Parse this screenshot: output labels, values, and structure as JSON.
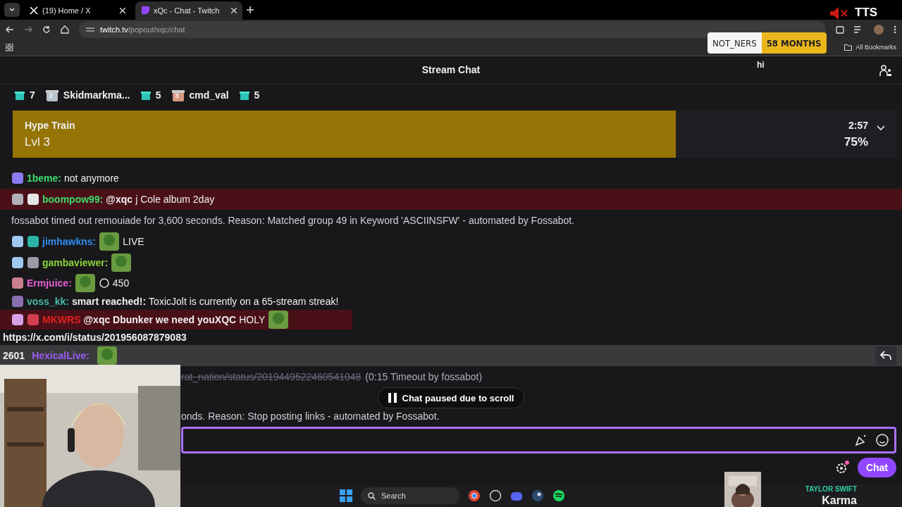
{
  "browser": {
    "tabs": [
      {
        "title": "(19) Home / X",
        "kind": "x",
        "selected": false
      },
      {
        "title": "xQc - Chat - Twitch",
        "kind": "twitch",
        "selected": true
      }
    ],
    "url_host": "twitch.tv",
    "url_path": "/popout/xqc/chat",
    "bookmarks_label": "All Bookmarks"
  },
  "overlay": {
    "sub_name": "NOT_NERS",
    "sub_months": "58 MONTHS",
    "tts": "TTS",
    "caption": "hi"
  },
  "chat": {
    "title": "Stream Chat",
    "leaderboard": [
      {
        "kind": "count",
        "text": "7"
      },
      {
        "kind": "user",
        "rank": "2",
        "name": "Skidmarkma..."
      },
      {
        "kind": "count",
        "text": "5"
      },
      {
        "kind": "user",
        "rank": "3",
        "name": "cmd_val"
      },
      {
        "kind": "count",
        "text": "5"
      }
    ],
    "hype_train": {
      "title": "Hype Train",
      "level_text": "Lvl 3",
      "time": "2:57",
      "percent": "75%",
      "level": 0.75
    },
    "messages": [
      {
        "kind": "chat",
        "user": "1beme:",
        "color": "#3ddc6c",
        "highlighted": false,
        "badges": [
          {
            "color": "#8a7cf0"
          }
        ],
        "parts": [
          {
            "kind": "text",
            "text": "not anymore"
          }
        ]
      },
      {
        "kind": "chat",
        "user": "boompow99:",
        "color": "#3ddc6c",
        "highlighted": true,
        "badges": [
          {
            "color": "#b0b0b8"
          },
          {
            "color": "#e6e6e6"
          }
        ],
        "parts": [
          {
            "kind": "mention",
            "text": "@xqc"
          },
          {
            "kind": "text",
            "text": "j Cole album 2day"
          }
        ]
      },
      {
        "kind": "system",
        "text": "fossabot timed out remouiade for 3,600 seconds. Reason: Matched group 49 in Keyword 'ASCIINSFW' - automated by Fossabot."
      },
      {
        "kind": "chat",
        "user": "jimhawkns:",
        "color": "#2f8cf0",
        "highlighted": false,
        "badges": [
          {
            "color": "#9ec8f0"
          },
          {
            "color": "#2bb3a8"
          }
        ],
        "parts": [
          {
            "kind": "emote"
          },
          {
            "kind": "text",
            "text": "LIVE"
          }
        ]
      },
      {
        "kind": "chat",
        "user": "gambaviewer:",
        "color": "#8ad43c",
        "highlighted": false,
        "badges": [
          {
            "color": "#9ec8f0"
          },
          {
            "color": "#9a9aa8"
          }
        ],
        "parts": [
          {
            "kind": "emote"
          }
        ]
      },
      {
        "kind": "chat",
        "user": "Ermjuice:",
        "color": "#e35fd0",
        "highlighted": false,
        "badges": [
          {
            "color": "#c9808a"
          }
        ],
        "parts": [
          {
            "kind": "emote"
          },
          {
            "kind": "points",
            "text": "450"
          }
        ]
      },
      {
        "kind": "chat",
        "user": "voss_kk:",
        "color": "#4bb8a8",
        "highlighted": false,
        "badges": [
          {
            "color": "#8a70b0"
          }
        ],
        "parts": [
          {
            "kind": "mention",
            "text": "smart"
          },
          {
            "kind": "mention",
            "text": "reached!:"
          },
          {
            "kind": "text",
            "text": "ToxicJolt is currently on a 65-stream streak!"
          }
        ]
      },
      {
        "kind": "chat",
        "user": "MKWRS",
        "color": "#e0201c",
        "highlighted": true,
        "badges": [
          {
            "color": "#d8a0e8"
          },
          {
            "color": "#d04050"
          }
        ],
        "parts": [
          {
            "kind": "mention",
            "text": "@xqc Dbunker we need youXQC"
          },
          {
            "kind": "text",
            "text": "HOLY"
          },
          {
            "kind": "emote"
          }
        ]
      },
      {
        "kind": "link",
        "text": "https://x.com/i/status/201956087879083"
      },
      {
        "kind": "hover",
        "count": "2601",
        "user": "HexicalLive:",
        "color": "#9a5cf0"
      }
    ],
    "timeout_link": "rat_nation/status/2019449522460541048",
    "timeout_note": "(0:15 Timeout by fossabot)",
    "paused_notice": "Chat paused due to scroll",
    "reason_tail": "onds. Reason: Stop posting links - automated by Fossabot.",
    "chat_button": "Chat"
  },
  "taskbar": {
    "search": "Search"
  },
  "now_playing": {
    "artist": "TAYLOR SWIFT",
    "title": "Karma"
  }
}
